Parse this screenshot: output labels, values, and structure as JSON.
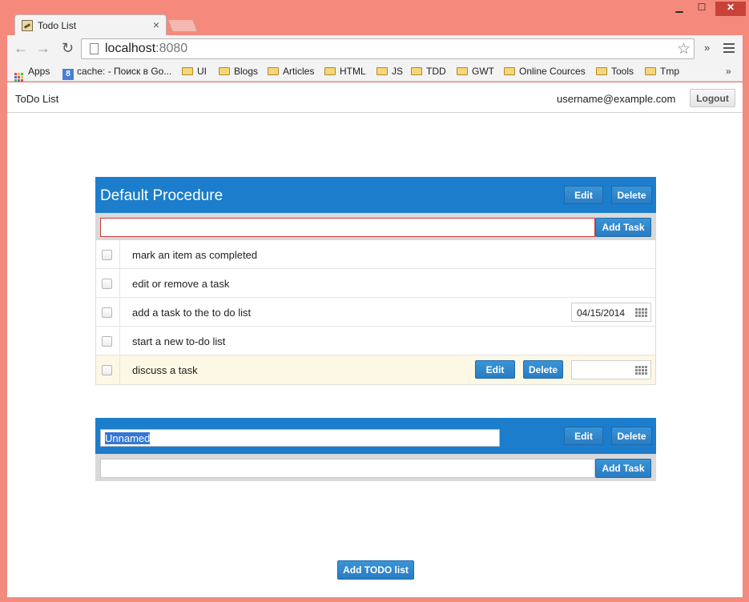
{
  "browser": {
    "tab_title": "Todo List",
    "tab_close": "×",
    "window_controls": {
      "minimize": "▁",
      "maximize": "☐",
      "close": "✕"
    },
    "url_host": "localhost",
    "url_port": ":8080",
    "bookmarks": [
      {
        "label": "Apps",
        "icon": "apps-icon"
      },
      {
        "label": "cache: - Поиск в Go...",
        "icon": "google-icon"
      },
      {
        "label": "UI",
        "icon": "folder-icon"
      },
      {
        "label": "Blogs",
        "icon": "folder-icon"
      },
      {
        "label": "Articles",
        "icon": "folder-icon"
      },
      {
        "label": "HTML",
        "icon": "folder-icon"
      },
      {
        "label": "JS",
        "icon": "folder-icon"
      },
      {
        "label": "TDD",
        "icon": "folder-icon"
      },
      {
        "label": "GWT",
        "icon": "folder-icon"
      },
      {
        "label": "Online Cources",
        "icon": "folder-icon"
      },
      {
        "label": "Tools",
        "icon": "folder-icon"
      },
      {
        "label": "Tmp",
        "icon": "folder-icon"
      }
    ],
    "bookmarks_more": "»",
    "toolbar_more": "»"
  },
  "header": {
    "brand": "ToDo List",
    "user_email": "username@example.com",
    "logout_label": "Logout"
  },
  "projects": [
    {
      "title": "Default Procedure",
      "edit_label": "Edit",
      "delete_label": "Delete",
      "new_task_value": "",
      "add_task_label": "Add Task",
      "tasks": [
        {
          "text": "mark an item as completed",
          "done": false
        },
        {
          "text": "edit or remove a task",
          "done": false
        },
        {
          "text": "add a task to the to do list",
          "done": false,
          "date": "04/15/2014"
        },
        {
          "text": "start a new to-do list",
          "done": false
        },
        {
          "text": "discuss a task",
          "done": false,
          "hover": true,
          "date": "",
          "edit_label": "Edit",
          "delete_label": "Delete"
        }
      ]
    },
    {
      "title_input_value": "Unnamed",
      "edit_label": "Edit",
      "delete_label": "Delete",
      "new_task_value": "",
      "add_task_label": "Add Task"
    }
  ],
  "footer": {
    "add_todo_label": "Add TODO list"
  },
  "colors": {
    "header_blue": "#1b7dcc",
    "button_blue": "#2a7cc2",
    "hover_row": "#fcf8e5",
    "error_border": "#d23a3a",
    "window_frame": "#f58a7c"
  }
}
